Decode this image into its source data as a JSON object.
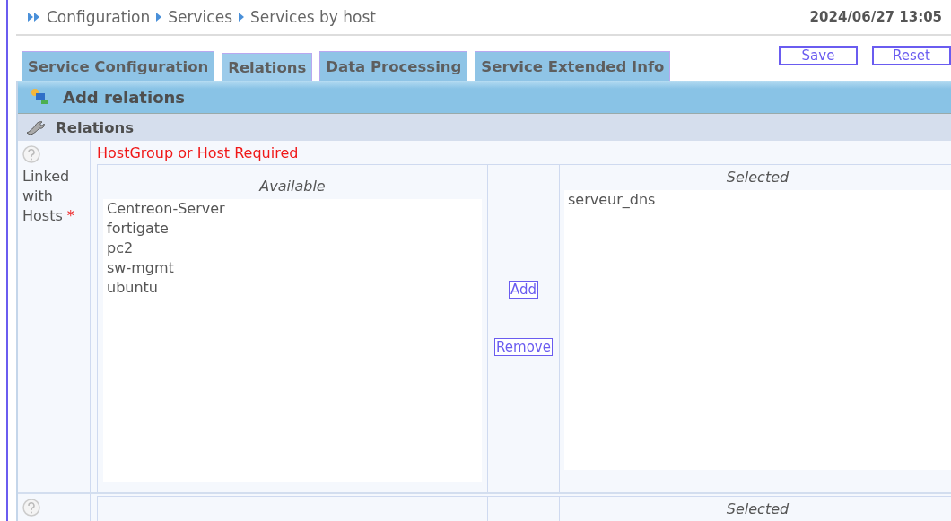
{
  "breadcrumb": [
    "Configuration",
    "Services",
    "Services by host"
  ],
  "datetime": "2024/06/27 13:05",
  "tabs": [
    {
      "label": "Service Configuration",
      "selected": false
    },
    {
      "label": "Relations",
      "selected": true
    },
    {
      "label": "Data Processing",
      "selected": false
    },
    {
      "label": "Service Extended Info",
      "selected": false
    }
  ],
  "buttons": [
    "Save",
    "Reset"
  ],
  "header": "Add relations",
  "section": "Relations",
  "rows": [
    {
      "error": "HostGroup or Host Required",
      "label": "Linked with Hosts",
      "required_mark": "*",
      "available_title": "Available",
      "available": [
        "Centreon-Server",
        "fortigate",
        "pc2",
        "sw-mgmt",
        "ubuntu"
      ],
      "add": "Add",
      "remove": "Remove",
      "selected_title": "Selected",
      "selected": [
        "serveur_dns"
      ]
    },
    {
      "selected_title": "Selected"
    }
  ]
}
